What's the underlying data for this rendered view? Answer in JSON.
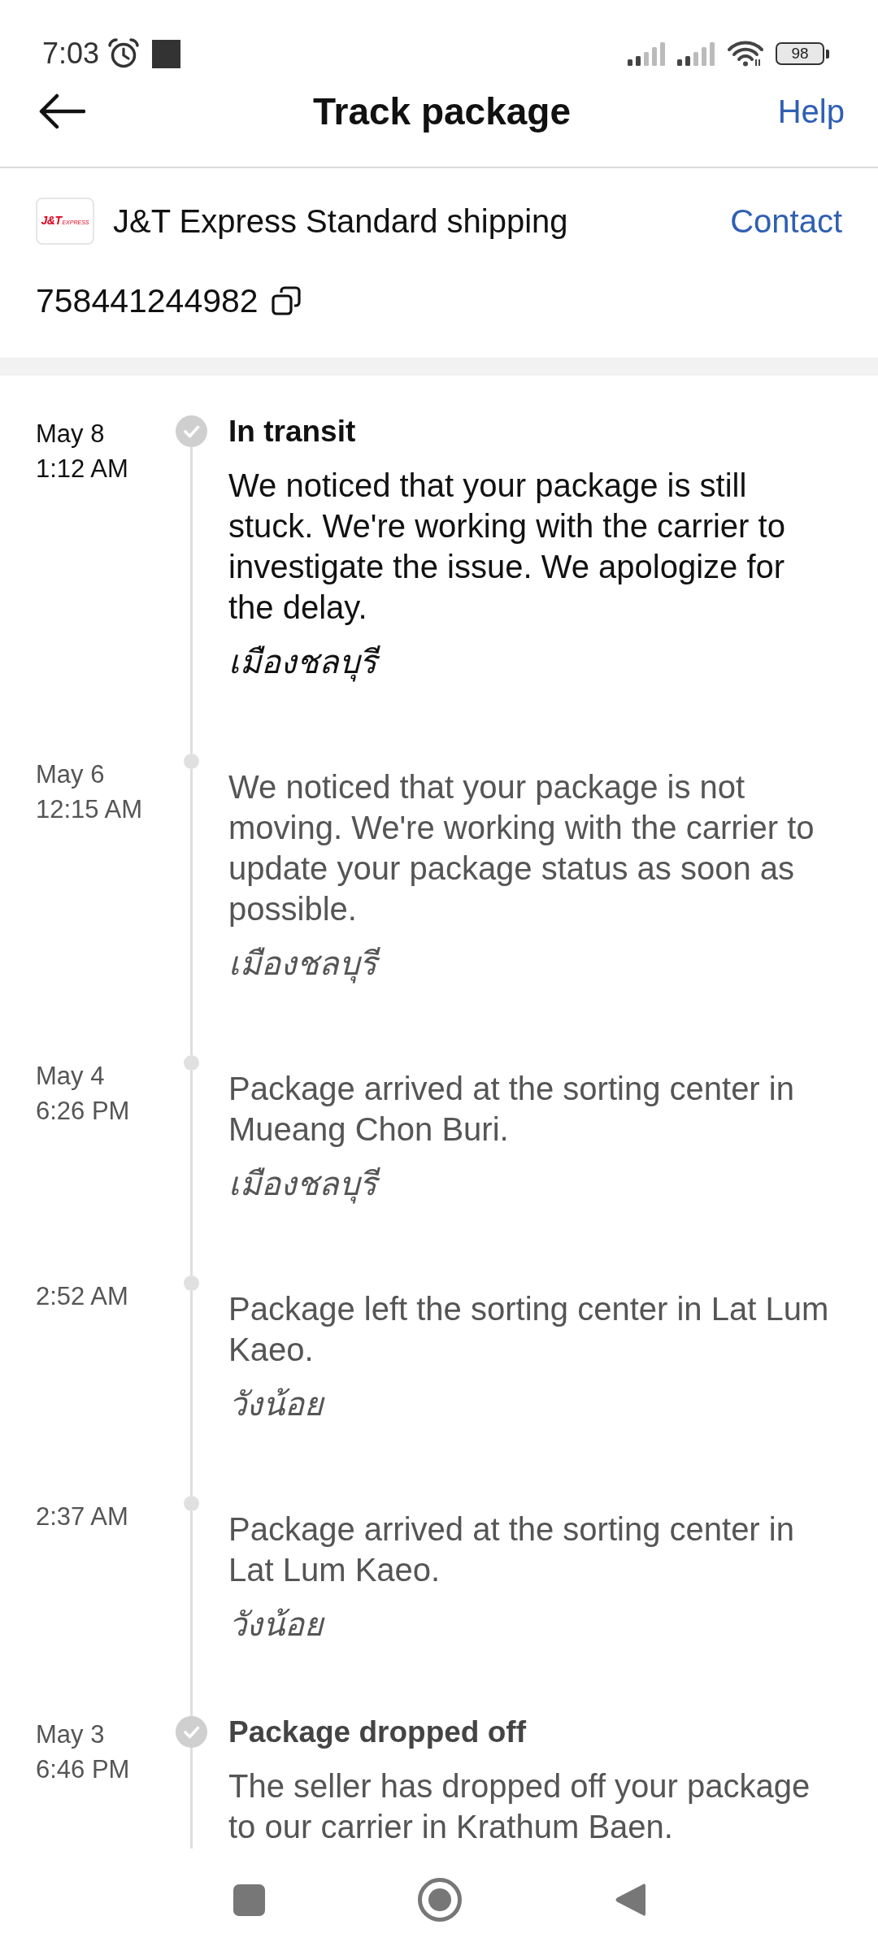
{
  "status_bar": {
    "time": "7:03",
    "battery": "98"
  },
  "header": {
    "title": "Track package",
    "help": "Help"
  },
  "shipment": {
    "logo": {
      "mark": "J&T",
      "tagline": "EXPRESS"
    },
    "carrier": "J&T Express Standard shipping",
    "contact": "Contact",
    "tracking_number": "758441244982"
  },
  "timeline": [
    {
      "kind": "milestone",
      "current": true,
      "date": "May 8",
      "time": "1:12 AM",
      "title": "In transit",
      "description": "We noticed that your package is still stuck. We're working with the carrier to investigate the issue. We apologize for the delay.",
      "location": "เมืองชลบุรี"
    },
    {
      "kind": "update",
      "current": false,
      "date": "May 6",
      "time": "12:15 AM",
      "description": "We noticed that your package is not moving. We're working with the carrier to update your package status as soon as possible.",
      "location": "เมืองชลบุรี"
    },
    {
      "kind": "update",
      "current": false,
      "date": "May 4",
      "time": "6:26 PM",
      "description": "Package arrived at the sorting center in Mueang Chon Buri.",
      "location": "เมืองชลบุรี"
    },
    {
      "kind": "update",
      "current": false,
      "time": "2:52 AM",
      "description": "Package left the sorting center in Lat Lum Kaeo.",
      "location": "วังน้อย"
    },
    {
      "kind": "update",
      "current": false,
      "time": "2:37 AM",
      "description": "Package arrived at the sorting center in Lat Lum Kaeo.",
      "location": "วังน้อย"
    },
    {
      "kind": "milestone",
      "current": false,
      "date": "May 3",
      "time": "6:46 PM",
      "title": "Package dropped off",
      "description": "The seller has dropped off your package to our carrier in Krathum Baen."
    }
  ]
}
